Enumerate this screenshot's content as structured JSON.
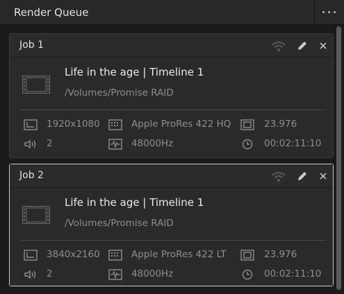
{
  "panel": {
    "title": "Render Queue"
  },
  "jobs": [
    {
      "name": "Job 1",
      "title": "Life in the age | Timeline 1",
      "path": "/Volumes/Promise RAID",
      "resolution": "1920x1080",
      "codec": "Apple ProRes 422 HQ",
      "frame_rate": "23.976",
      "audio_channels": "2",
      "sample_rate": "48000Hz",
      "duration": "00:02:11:10",
      "selected": false
    },
    {
      "name": "Job 2",
      "title": "Life in the age | Timeline 1",
      "path": "/Volumes/Promise RAID",
      "resolution": "3840x2160",
      "codec": "Apple ProRes 422 LT",
      "frame_rate": "23.976",
      "audio_channels": "2",
      "sample_rate": "48000Hz",
      "duration": "00:02:11:10",
      "selected": true
    }
  ],
  "icons": {
    "remote": "remote-render-icon",
    "edit": "pencil-icon",
    "close": "close-icon",
    "thumbnail": "film-clip-icon",
    "resolution": "resolution-icon",
    "codec": "codec-icon",
    "frame_rate": "frame-rate-icon",
    "audio": "speaker-icon",
    "sample_rate": "waveform-icon",
    "duration": "clock-icon"
  },
  "colors": {
    "background": "#1b1b1d",
    "card": "#2a2a2b",
    "selected_border": "#c9c9c9",
    "muted_text": "#8e8e90"
  }
}
